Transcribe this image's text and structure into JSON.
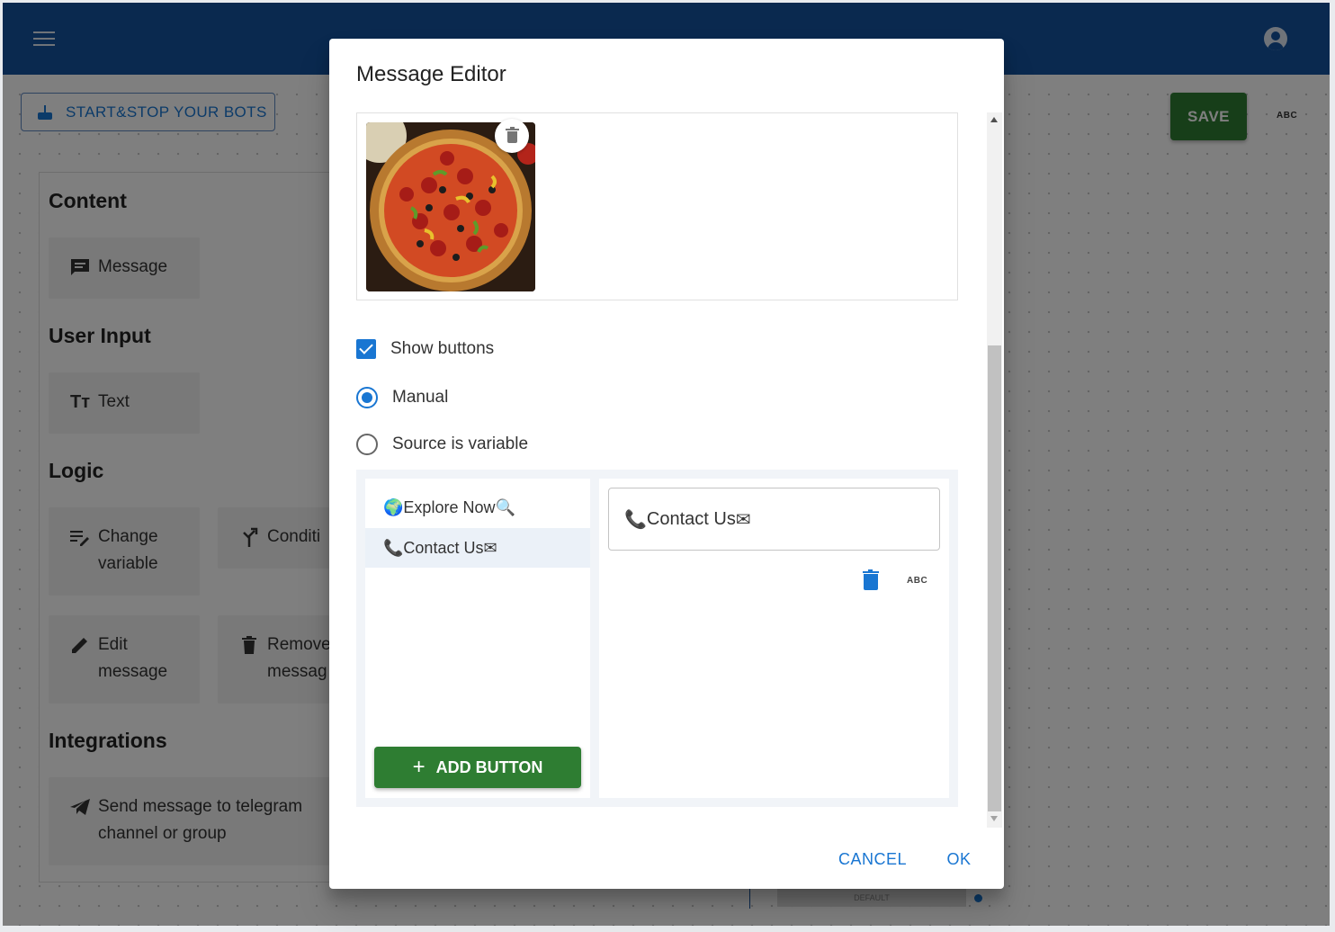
{
  "topbar": {
    "menu_icon": "menu-icon",
    "account_icon": "account-circle-icon"
  },
  "toolbar": {
    "start_label": "START&STOP YOUR BOTS",
    "save_label": "SAVE",
    "abc_label": "ABC"
  },
  "palette": {
    "sections": [
      {
        "title": "Content",
        "items": [
          "Message"
        ]
      },
      {
        "title": "User Input",
        "items": [
          "Text"
        ]
      },
      {
        "title": "Logic",
        "items": [
          "Change variable",
          "Condition",
          "Edit message",
          "Remove message"
        ]
      },
      {
        "title": "Integrations",
        "items": [
          "Send message to telegram channel or group"
        ]
      }
    ],
    "visible_text": {
      "content": "Content",
      "message": "Message",
      "user_input": "User Input",
      "text": "Text",
      "logic": "Logic",
      "change_variable_l1": "Change",
      "change_variable_l2": "variable",
      "condition": "Conditi",
      "edit_message_l1": "Edit",
      "edit_message_l2": "message",
      "remove_message_l1": "Remove",
      "remove_message_l2": "messag",
      "integrations": "Integrations",
      "telegram_l1": "Send message to telegram",
      "telegram_l2": "channel or group"
    }
  },
  "canvas": {
    "default_label": "DEFAULT"
  },
  "dialog": {
    "title": "Message Editor",
    "image_alt": "pizza image",
    "show_buttons_label": "Show buttons",
    "show_buttons_checked": true,
    "radio_manual_label": "Manual",
    "radio_variable_label": "Source is variable",
    "radio_selected": "Manual",
    "buttons": [
      {
        "label": "Explore Now",
        "prefix": "🌍",
        "suffix": "🔍"
      },
      {
        "label": "Contact Us",
        "prefix": "📞",
        "suffix": "✉"
      }
    ],
    "selected_button_value": "Contact Us",
    "selected_button_prefix": "📞",
    "selected_button_suffix": "✉",
    "add_button_label": "ADD BUTTON",
    "abc_label": "ABC",
    "cancel_label": "CANCEL",
    "ok_label": "OK"
  }
}
